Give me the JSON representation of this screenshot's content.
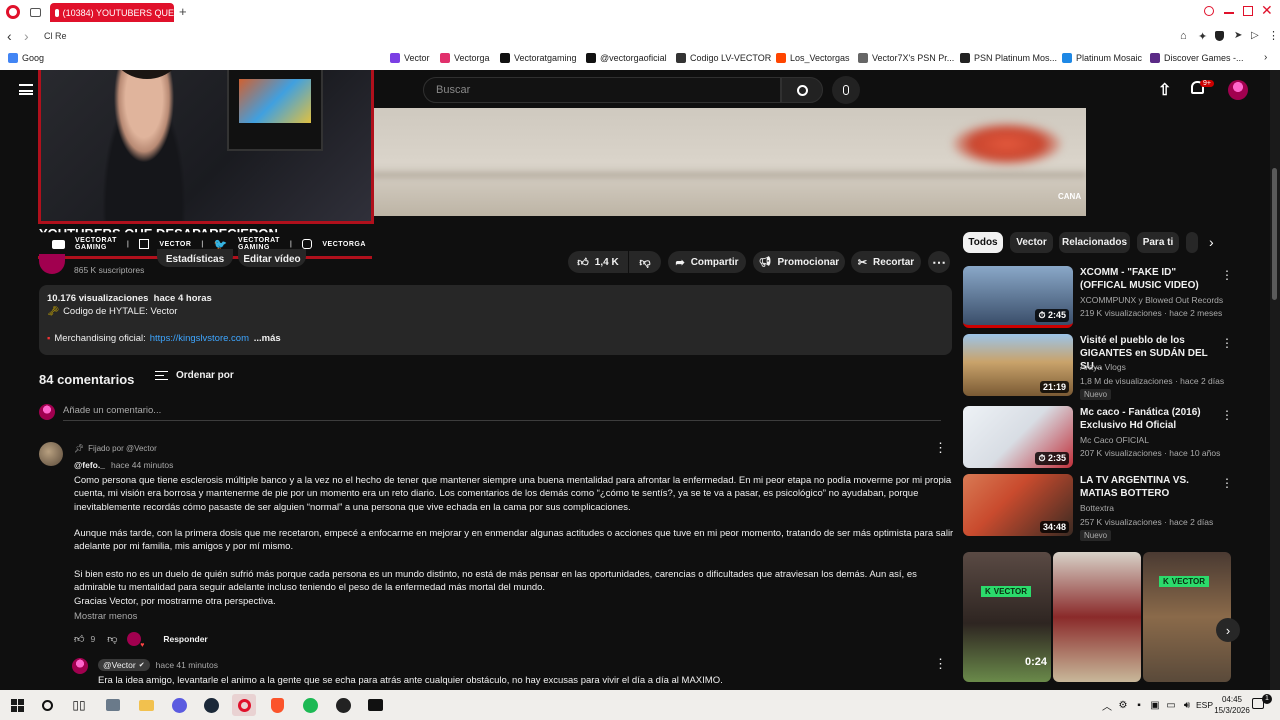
{
  "browser": {
    "tab_title": "(10384) YOUTUBERS QUE",
    "tab_plus": "+",
    "address_partial": "Cl Re",
    "bookmarks": [
      {
        "label": "Goog",
        "color": "#4285f4"
      },
      {
        "label": "Vector",
        "color": "#7b3fe4"
      },
      {
        "label": "Vectorga",
        "color": "#e1306c"
      },
      {
        "label": "Vectoratgaming",
        "color": "#111111"
      },
      {
        "label": "@vectorgaoficial",
        "color": "#111111"
      },
      {
        "label": "Codigo LV-VECTOR",
        "color": "#333333"
      },
      {
        "label": "Los_Vectorgas",
        "color": "#ff4500"
      },
      {
        "label": "Vector7X's PSN Pr...",
        "color": "#666666"
      },
      {
        "label": "PSN Platinum Mos...",
        "color": "#222222"
      },
      {
        "label": "Platinum Mosaic",
        "color": "#1e88e5"
      },
      {
        "label": "Discover Games -...",
        "color": "#5b2a86"
      }
    ]
  },
  "youtube": {
    "search_placeholder": "Buscar",
    "notif_count": "9+",
    "video_title": "YOUTUBERS QUE DESAPARECIERON",
    "player_watermark": "CANA",
    "webcam_socials": [
      {
        "icon": "youtube-icon",
        "line1": "VECTORAT",
        "line2": "GAMING"
      },
      {
        "icon": "twitch-icon",
        "line1": "VECTOR",
        "line2": ""
      },
      {
        "icon": "twitter-icon",
        "line1": "VECTORAT",
        "line2": "GAMING"
      },
      {
        "icon": "instagram-icon",
        "line1": "VECTORGA",
        "line2": ""
      }
    ],
    "subscribers": "865 K suscriptores",
    "stats_button": "Estadísticas",
    "edit_button": "Editar vídeo",
    "like_count": "1,4 K",
    "share_label": "Compartir",
    "promote_label": "Promocionar",
    "clip_label": "Recortar",
    "description": {
      "meta": "10.176 visualizaciones  hace 4 horas",
      "line1": "Codigo de HYTALE: Vector",
      "merch_label": "Merchandising oficial:",
      "merch_link": "https://kingslvstore.com",
      "more": "...más"
    },
    "comments": {
      "count_label": "84 comentarios",
      "sort_label": "Ordenar por",
      "add_placeholder": "Añade un comentario...",
      "pinned": {
        "pinned_label": "Fijado por @Vector",
        "author": "@fefo._",
        "time": "hace 44 minutos",
        "paragraphs": [
          "Como persona que tiene esclerosis múltiple banco y a la vez no el hecho de tener que mantener siempre una buena mentalidad para afrontar la enfermedad. En mi peor etapa no podía moverme por mi propia cuenta, mi visión era borrosa y mantenerme de pie por un momento era un reto diario. Los comentarios de los demás como “¿cómo te sentís?, ya se te va a pasar, es psicológico” no ayudaban, porque inevitablemente recordás cómo pasaste de ser alguien “normal” a una persona que vive echada en la cama por sus complicaciones.",
          "Aunque más tarde, con la primera dosis que me recetaron, empecé a enfocarme en mejorar y en enmendar algunas actitudes o acciones que tuve en mi peor momento, tratando de ser más optimista para salir adelante por mi familia, mis amigos y por mí mismo.",
          "Si bien esto no es un duelo de quién sufrió más porque cada persona es un mundo distinto, no está de más pensar en las oportunidades, carencias o dificultades que atraviesan los demás. Aun así, es admirable tu mentalidad para seguir adelante incluso teniendo el peso de la enfermedad más mortal del mundo.\nGracias Vector, por mostrarme otra perspectiva."
        ],
        "show_less": "Mostrar menos",
        "likes": "9",
        "reply_label": "Responder"
      },
      "reply": {
        "author": "@Vector",
        "time": "hace 41 minutos",
        "text": "Era la idea amigo, levantarle el animo a la gente que se echa para atrás ante cualquier obstáculo, no hay excusas para vivir el día a día al MAXIMO."
      }
    },
    "chips": [
      "Todos",
      "Vector",
      "Relacionados",
      "Para ti"
    ],
    "recommendations": [
      {
        "title": "XCOMM - \"FAKE ID\" (OFFICAL MUSIC VIDEO)",
        "channel": "XCOMMPUNX y Blowed Out Records",
        "meta": "219 K visualizaciones · hace 2 meses",
        "duration": "2:45",
        "badge": "",
        "colors": [
          "#6f8fb5",
          "#2d3d55"
        ]
      },
      {
        "title": "Visité el pueblo de los GIGANTES en SUDÁN DEL SU...",
        "channel": "Araya Vlogs",
        "meta": "1,8 M de visualizaciones · hace 2 días",
        "duration": "21:19",
        "badge": "Nuevo",
        "colors": [
          "#c9a36b",
          "#7a5a34"
        ]
      },
      {
        "title": "Mc caco - Fanática (2016) Exclusivo Hd Oficial",
        "channel": "Mc Caco OFICIAL",
        "meta": "207 K visualizaciones · hace 10 años",
        "duration": "2:35",
        "badge": "",
        "colors": [
          "#e0e6ee",
          "#c0303a"
        ]
      },
      {
        "title": "LA TV ARGENTINA VS. MATIAS BOTTERO",
        "channel": "Bottextra",
        "meta": "257 K visualizaciones · hace 2 días",
        "duration": "34:48",
        "badge": "Nuevo",
        "colors": [
          "#c94b2e",
          "#3a2a22"
        ]
      }
    ],
    "shorts": [
      {
        "tag": "VECTOR",
        "duration": "0:24"
      },
      {
        "tag": "",
        "duration": ""
      },
      {
        "tag": "VECTOR",
        "duration": ""
      }
    ]
  },
  "taskbar": {
    "lang": "ESP",
    "time": "04:45",
    "date": "15/3/2026",
    "notif": "1"
  }
}
